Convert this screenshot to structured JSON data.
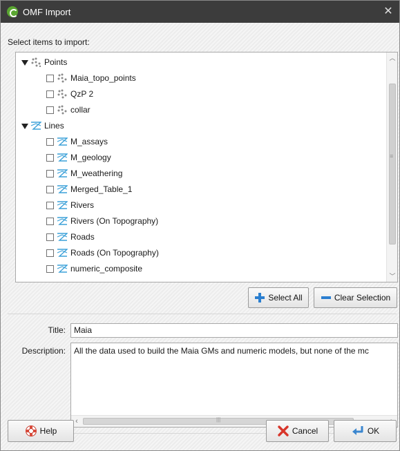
{
  "window": {
    "title": "OMF Import",
    "close_glyph": "✕"
  },
  "select_label": "Select items to import:",
  "tree": {
    "points": {
      "label": "Points",
      "icon": "points-icon",
      "children": [
        {
          "label": "Maia_topo_points"
        },
        {
          "label": "QzP 2"
        },
        {
          "label": "collar"
        }
      ]
    },
    "lines": {
      "label": "Lines",
      "icon": "lines-icon",
      "children": [
        {
          "label": "M_assays"
        },
        {
          "label": "M_geology"
        },
        {
          "label": "M_weathering"
        },
        {
          "label": "Merged_Table_1"
        },
        {
          "label": "Rivers"
        },
        {
          "label": "Rivers (On Topography)"
        },
        {
          "label": "Roads"
        },
        {
          "label": "Roads (On Topography)"
        },
        {
          "label": "numeric_composite"
        }
      ]
    }
  },
  "buttons": {
    "select_all": "Select All",
    "clear_selection": "Clear Selection",
    "help": "Help",
    "cancel": "Cancel",
    "ok": "OK"
  },
  "title_field": {
    "label": "Title:",
    "value": "Maia"
  },
  "description_field": {
    "label": "Description:",
    "value": "All the data used to build the Maia GMs and numeric models, but none of the mc"
  },
  "colors": {
    "titlebar": "#3c3c3c",
    "app_icon": "#5aa631",
    "lines_icon": "#3aa0d8",
    "points_icon": "#8a8a8a"
  }
}
